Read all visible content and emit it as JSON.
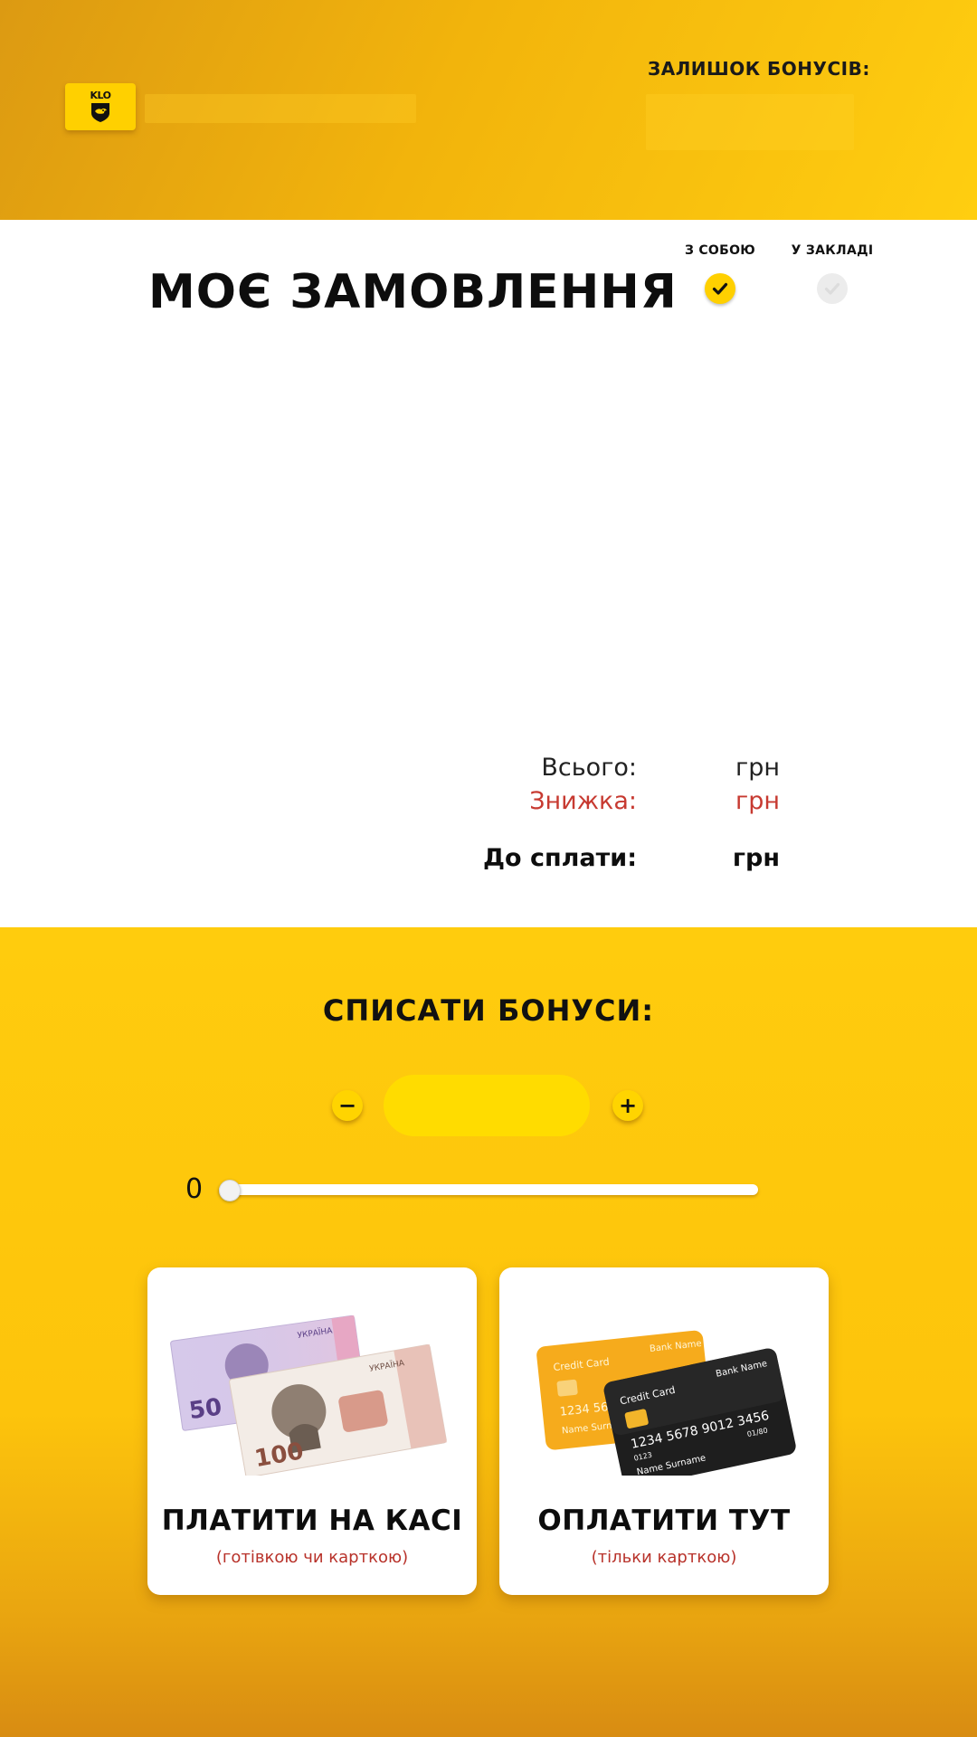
{
  "header": {
    "logo_text": "KLO",
    "bonus_balance_label": "ЗАЛИШОК БОНУСІВ:"
  },
  "order": {
    "title": "МОЄ ЗАМОВЛЕННЯ",
    "options": [
      {
        "label": "З СОБОЮ",
        "selected": true
      },
      {
        "label": "У ЗАКЛАДІ",
        "selected": false
      }
    ],
    "totals": {
      "total_label": "Всього:",
      "total_value": "грн",
      "discount_label": "Знижка:",
      "discount_value": "грн",
      "to_pay_label": "До сплати:",
      "to_pay_value": "грн"
    }
  },
  "bonus": {
    "title": "СПИСАТИ БОНУСИ:",
    "minus_label": "−",
    "plus_label": "+",
    "slider_min": "0",
    "slider_level": 0
  },
  "payment": {
    "cashier": {
      "title": "ПЛАТИТИ НА КАСІ",
      "subtitle": "(готівкою чи карткою)",
      "note_50": "50",
      "note_100": "100",
      "note_country": "УКРАЇНА"
    },
    "here": {
      "title": "ОПЛАТИТИ ТУТ",
      "subtitle": "(тільки карткою)",
      "card_label": "Credit Card",
      "bank_label": "Bank Name",
      "card_number": "1234 5678 9012 3456",
      "card_digits": "0123",
      "card_expiry": "01/80",
      "card_holder": "Name Surname"
    }
  },
  "colors": {
    "accent_yellow": "#ffd000",
    "discount_red": "#c73a31"
  }
}
